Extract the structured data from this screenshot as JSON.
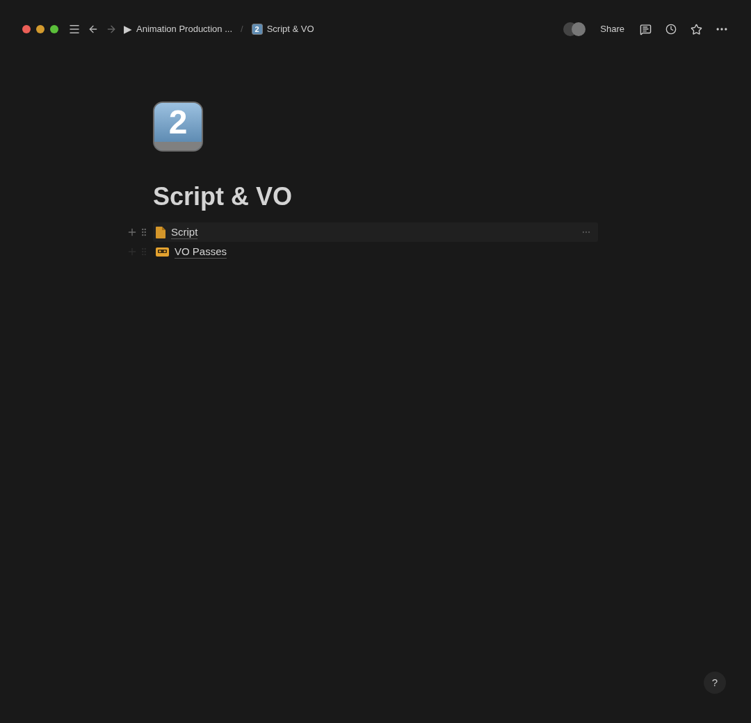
{
  "topbar": {
    "breadcrumbs": [
      {
        "icon": "▶",
        "label": "Animation Production ..."
      },
      {
        "icon": "2",
        "label": "Script & VO"
      }
    ],
    "separator": "/",
    "share": "Share"
  },
  "page": {
    "icon": "2",
    "title": "Script & VO",
    "items": [
      {
        "kind": "page",
        "label": "Script",
        "hovered": true
      },
      {
        "kind": "cassette",
        "label": "VO Passes",
        "hovered": false
      }
    ]
  },
  "help": "?"
}
